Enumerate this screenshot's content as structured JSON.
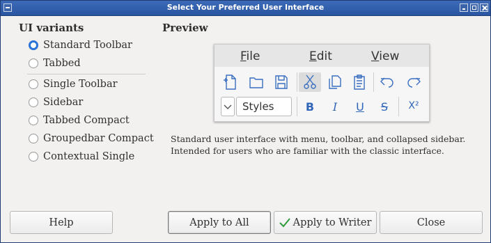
{
  "window": {
    "title": "Select Your Preferred User Interface"
  },
  "variants": {
    "heading": "UI variants",
    "items": [
      {
        "label": "Standard Toolbar",
        "checked": true
      },
      {
        "label": "Tabbed",
        "checked": false
      },
      {
        "label": "Single Toolbar",
        "checked": false
      },
      {
        "label": "Sidebar",
        "checked": false
      },
      {
        "label": "Tabbed Compact",
        "checked": false
      },
      {
        "label": "Groupedbar Compact",
        "checked": false
      },
      {
        "label": "Contextual Single",
        "checked": false
      }
    ]
  },
  "preview": {
    "heading": "Preview",
    "menu": [
      {
        "mnemonic": "F",
        "rest": "ile"
      },
      {
        "mnemonic": "E",
        "rest": "dit"
      },
      {
        "mnemonic": "V",
        "rest": "iew"
      }
    ],
    "style_box": "Styles",
    "format": {
      "bold": "B",
      "italic": "I",
      "underline": "U",
      "strike": "S",
      "superscript": "X²"
    },
    "icons": [
      "new-document-icon",
      "open-folder-icon",
      "save-icon",
      "cut-icon",
      "copy-icon",
      "paste-icon",
      "undo-icon",
      "redo-icon"
    ],
    "accent_color": "#2f66b8"
  },
  "description": {
    "line1": "Standard user interface with menu, toolbar, and collapsed sidebar.",
    "line2": "Intended for users who are familiar with the classic interface."
  },
  "buttons": {
    "help": "Help",
    "apply_all": "Apply to All",
    "apply_writer": "Apply to Writer",
    "close": "Close"
  }
}
